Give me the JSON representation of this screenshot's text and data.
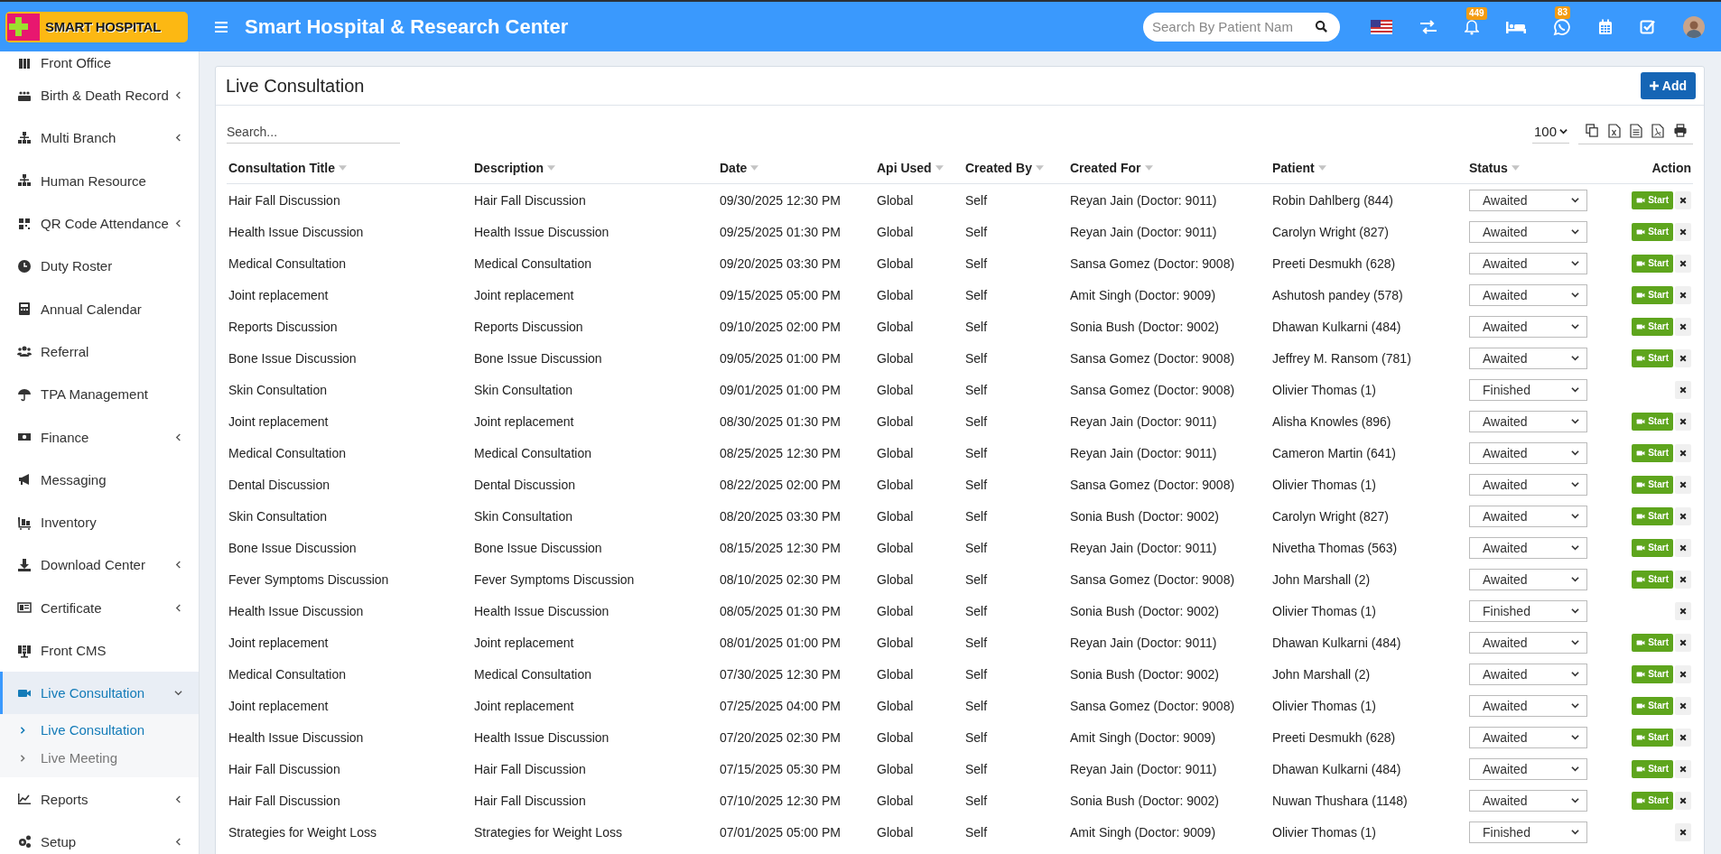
{
  "header": {
    "logo_text": "SMART HOSPITAL",
    "title": "Smart Hospital & Research Center",
    "search": {
      "placeholder": "Search By Patient Nam"
    },
    "notifications_badge": "449",
    "messages_badge": "83"
  },
  "sidebar": {
    "items": [
      {
        "label": "Front Office",
        "selected": false
      },
      {
        "label": "Birth & Death Record",
        "expanded": false,
        "selected": false
      },
      {
        "label": "Multi Branch",
        "expanded": false,
        "selected": false
      },
      {
        "label": "Human Resource",
        "selected": false
      },
      {
        "label": "QR Code Attendance",
        "expanded": false,
        "selected": false
      },
      {
        "label": "Duty Roster",
        "selected": false
      },
      {
        "label": "Annual Calendar",
        "selected": false
      },
      {
        "label": "Referral",
        "selected": false
      },
      {
        "label": "TPA Management",
        "selected": false
      },
      {
        "label": "Finance",
        "expanded": false,
        "selected": false
      },
      {
        "label": "Messaging",
        "selected": false
      },
      {
        "label": "Inventory",
        "selected": false
      },
      {
        "label": "Download Center",
        "expanded": false,
        "selected": false
      },
      {
        "label": "Certificate",
        "expanded": false,
        "selected": false
      },
      {
        "label": "Front CMS",
        "selected": false
      },
      {
        "label": "Live Consultation",
        "expanded": true,
        "selected": true,
        "children": [
          {
            "label": "Live Consultation",
            "selected": true
          },
          {
            "label": "Live Meeting",
            "selected": false
          }
        ]
      },
      {
        "label": "Reports",
        "expanded": false,
        "selected": false
      },
      {
        "label": "Setup",
        "expanded": false,
        "selected": false
      }
    ]
  },
  "card": {
    "title": "Live Consultation",
    "add_button": "Add",
    "search": {
      "placeholder": "Search..."
    },
    "page_size": "100"
  },
  "table": {
    "columns": [
      {
        "label": "Consultation Title",
        "sortable": true
      },
      {
        "label": "Description",
        "sortable": true
      },
      {
        "label": "Date",
        "sortable": true
      },
      {
        "label": "Api Used",
        "sortable": true
      },
      {
        "label": "Created By",
        "sortable": true
      },
      {
        "label": "Created For",
        "sortable": true
      },
      {
        "label": "Patient",
        "sortable": true
      },
      {
        "label": "Status",
        "sortable": true
      },
      {
        "label": "Action"
      }
    ],
    "rows": [
      {
        "cells": [
          "Hair Fall Discussion",
          "Hair Fall Discussion",
          "09/30/2025 12:30 PM",
          "Global",
          "Self",
          "Reyan Jain (Doctor: 9011)",
          "Robin Dahlberg (844)"
        ],
        "status": "Awaited",
        "start": "Start"
      },
      {
        "cells": [
          "Health Issue Discussion",
          "Health Issue Discussion",
          "09/25/2025 01:30 PM",
          "Global",
          "Self",
          "Reyan Jain (Doctor: 9011)",
          "Carolyn Wright (827)"
        ],
        "status": "Awaited",
        "start": "Start"
      },
      {
        "cells": [
          "Medical Consultation",
          "Medical Consultation",
          "09/20/2025 03:30 PM",
          "Global",
          "Self",
          "Sansa Gomez (Doctor: 9008)",
          "Preeti Desmukh (628)"
        ],
        "status": "Awaited",
        "start": "Start"
      },
      {
        "cells": [
          "Joint replacement",
          "Joint replacement",
          "09/15/2025 05:00 PM",
          "Global",
          "Self",
          "Amit Singh (Doctor: 9009)",
          "Ashutosh pandey (578)"
        ],
        "status": "Awaited",
        "start": "Start"
      },
      {
        "cells": [
          "Reports Discussion",
          "Reports Discussion",
          "09/10/2025 02:00 PM",
          "Global",
          "Self",
          "Sonia Bush (Doctor: 9002)",
          "Dhawan Kulkarni (484)"
        ],
        "status": "Awaited",
        "start": "Start"
      },
      {
        "cells": [
          "Bone Issue Discussion",
          "Bone Issue Discussion",
          "09/05/2025 01:00 PM",
          "Global",
          "Self",
          "Sansa Gomez (Doctor: 9008)",
          "Jeffrey M. Ransom (781)"
        ],
        "status": "Awaited",
        "start": "Start"
      },
      {
        "cells": [
          "Skin Consultation",
          "Skin Consultation",
          "09/01/2025 01:00 PM",
          "Global",
          "Self",
          "Sansa Gomez (Doctor: 9008)",
          "Olivier Thomas (1)"
        ],
        "status": "Finished"
      },
      {
        "cells": [
          "Joint replacement",
          "Joint replacement",
          "08/30/2025 01:30 PM",
          "Global",
          "Self",
          "Reyan Jain (Doctor: 9011)",
          "Alisha Knowles (896)"
        ],
        "status": "Awaited",
        "start": "Start"
      },
      {
        "cells": [
          "Medical Consultation",
          "Medical Consultation",
          "08/25/2025 12:30 PM",
          "Global",
          "Self",
          "Reyan Jain (Doctor: 9011)",
          "Cameron Martin (641)"
        ],
        "status": "Awaited",
        "start": "Start"
      },
      {
        "cells": [
          "Dental Discussion",
          "Dental Discussion",
          "08/22/2025 02:00 PM",
          "Global",
          "Self",
          "Sansa Gomez (Doctor: 9008)",
          "Olivier Thomas (1)"
        ],
        "status": "Awaited",
        "start": "Start"
      },
      {
        "cells": [
          "Skin Consultation",
          "Skin Consultation",
          "08/20/2025 03:30 PM",
          "Global",
          "Self",
          "Sonia Bush (Doctor: 9002)",
          "Carolyn Wright (827)"
        ],
        "status": "Awaited",
        "start": "Start"
      },
      {
        "cells": [
          "Bone Issue Discussion",
          "Bone Issue Discussion",
          "08/15/2025 12:30 PM",
          "Global",
          "Self",
          "Reyan Jain (Doctor: 9011)",
          "Nivetha Thomas (563)"
        ],
        "status": "Awaited",
        "start": "Start"
      },
      {
        "cells": [
          "Fever Symptoms Discussion",
          "Fever Symptoms Discussion",
          "08/10/2025 02:30 PM",
          "Global",
          "Self",
          "Sansa Gomez (Doctor: 9008)",
          "John Marshall (2)"
        ],
        "status": "Awaited",
        "start": "Start"
      },
      {
        "cells": [
          "Health Issue Discussion",
          "Health Issue Discussion",
          "08/05/2025 01:30 PM",
          "Global",
          "Self",
          "Sonia Bush (Doctor: 9002)",
          "Olivier Thomas (1)"
        ],
        "status": "Finished"
      },
      {
        "cells": [
          "Joint replacement",
          "Joint replacement",
          "08/01/2025 01:00 PM",
          "Global",
          "Self",
          "Reyan Jain (Doctor: 9011)",
          "Dhawan Kulkarni (484)"
        ],
        "status": "Awaited",
        "start": "Start"
      },
      {
        "cells": [
          "Medical Consultation",
          "Medical Consultation",
          "07/30/2025 12:30 PM",
          "Global",
          "Self",
          "Sonia Bush (Doctor: 9002)",
          "John Marshall (2)"
        ],
        "status": "Awaited",
        "start": "Start"
      },
      {
        "cells": [
          "Joint replacement",
          "Joint replacement",
          "07/25/2025 04:00 PM",
          "Global",
          "Self",
          "Sansa Gomez (Doctor: 9008)",
          "Olivier Thomas (1)"
        ],
        "status": "Awaited",
        "start": "Start"
      },
      {
        "cells": [
          "Health Issue Discussion",
          "Health Issue Discussion",
          "07/20/2025 02:30 PM",
          "Global",
          "Self",
          "Amit Singh (Doctor: 9009)",
          "Preeti Desmukh (628)"
        ],
        "status": "Awaited",
        "start": "Start"
      },
      {
        "cells": [
          "Hair Fall Discussion",
          "Hair Fall Discussion",
          "07/15/2025 05:30 PM",
          "Global",
          "Self",
          "Reyan Jain (Doctor: 9011)",
          "Dhawan Kulkarni (484)"
        ],
        "status": "Awaited",
        "start": "Start"
      },
      {
        "cells": [
          "Hair Fall Discussion",
          "Hair Fall Discussion",
          "07/10/2025 12:30 PM",
          "Global",
          "Self",
          "Sonia Bush (Doctor: 9002)",
          "Nuwan Thushara (1148)"
        ],
        "status": "Awaited",
        "start": "Start"
      },
      {
        "cells": [
          "Strategies for Weight Loss",
          "Strategies for Weight Loss",
          "07/01/2025 05:00 PM",
          "Global",
          "Self",
          "Amit Singh (Doctor: 9009)",
          "Olivier Thomas (1)"
        ],
        "status": "Finished"
      }
    ]
  }
}
